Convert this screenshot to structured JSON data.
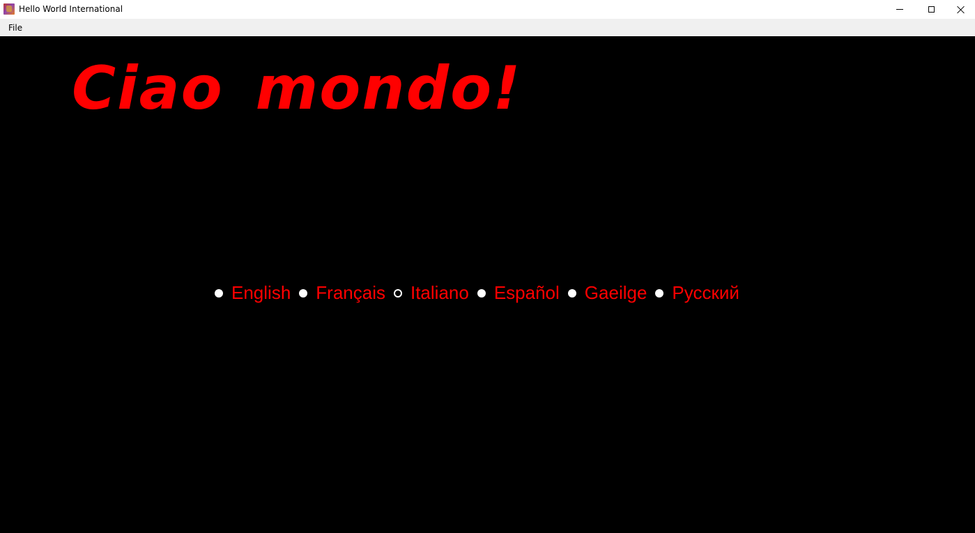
{
  "window": {
    "title": "Hello World International"
  },
  "menu": {
    "file_label": "File"
  },
  "greeting": {
    "text": "Ciao mondo!",
    "color": "#ff0000"
  },
  "languages": {
    "selected": "Italiano",
    "options": [
      {
        "label": "English",
        "selected": false
      },
      {
        "label": "Français",
        "selected": false
      },
      {
        "label": "Italiano",
        "selected": true
      },
      {
        "label": "Español",
        "selected": false
      },
      {
        "label": "Gaeilge",
        "selected": false
      },
      {
        "label": "Русский",
        "selected": false
      }
    ]
  },
  "colors": {
    "background": "#000000",
    "text": "#ff0000",
    "radio": "#ffffff"
  }
}
